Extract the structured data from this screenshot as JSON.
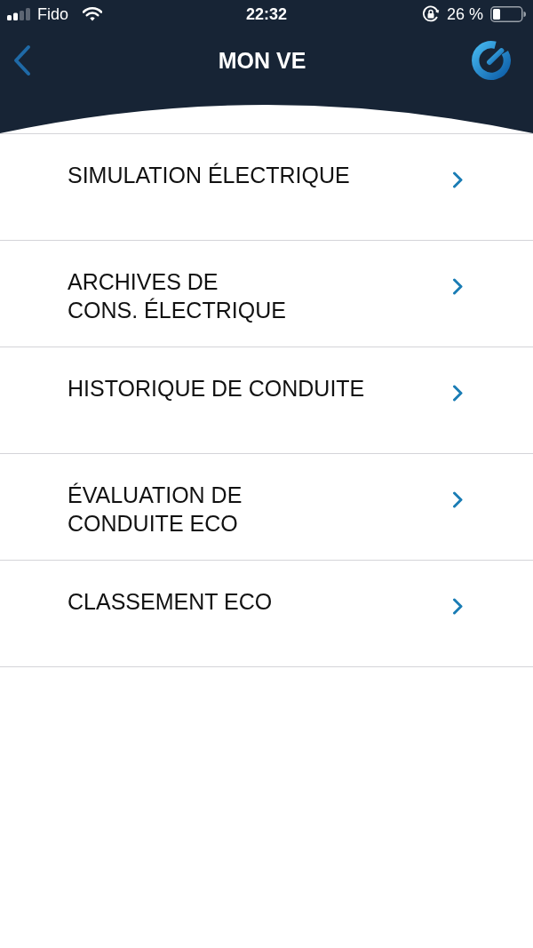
{
  "status_bar": {
    "carrier": "Fido",
    "time": "22:32",
    "battery": "26 %"
  },
  "nav": {
    "title": "MON VE"
  },
  "menu_items": [
    {
      "label": "SIMULATION ÉLECTRIQUE"
    },
    {
      "label": "ARCHIVES DE\nCONS. ÉLECTRIQUE"
    },
    {
      "label": "HISTORIQUE DE CONDUITE"
    },
    {
      "label": "ÉVALUATION DE\nCONDUITE ECO"
    },
    {
      "label": "CLASSEMENT ECO"
    }
  ]
}
